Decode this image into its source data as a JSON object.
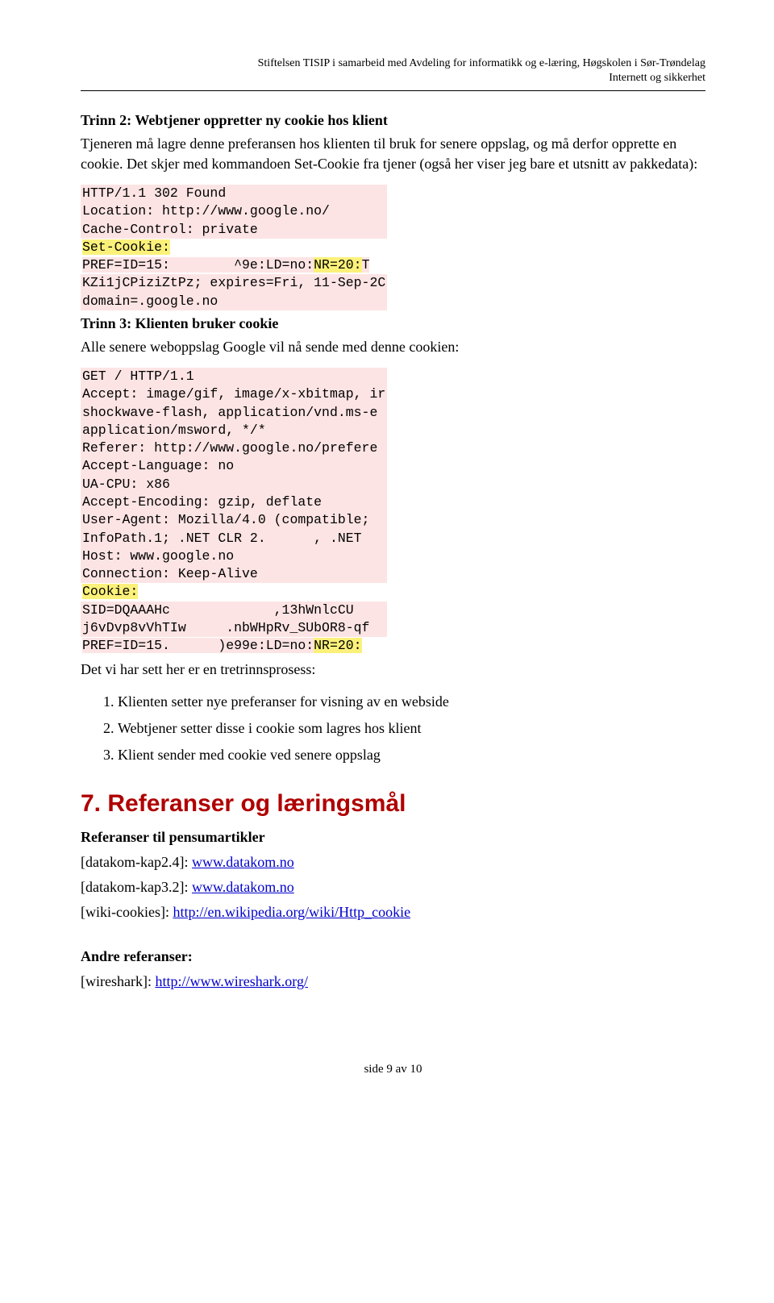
{
  "header": {
    "line1": "Stiftelsen TISIP i samarbeid med Avdeling for informatikk og e-læring, Høgskolen i Sør-Trøndelag",
    "line2": "Internett og sikkerhet"
  },
  "step2": {
    "title": "Trinn 2: Webtjener oppretter ny cookie hos klient",
    "para": "Tjeneren må lagre denne preferansen hos klienten til bruk for senere oppslag, og må derfor opprette en cookie. Det skjer med kommandoen Set-Cookie fra tjener (også her viser jeg bare et utsnitt av pakkedata):"
  },
  "step3": {
    "title": "Trinn 3: Klienten bruker cookie",
    "para": "Alle senere weboppslag Google vil nå sende med denne cookien:"
  },
  "summary": {
    "intro": "Det vi har sett her er en tretrinnsprosess:",
    "items": [
      "Klienten setter nye preferanser for visning av en webside",
      "Webtjener setter disse i cookie som lagres hos klient",
      "Klient sender med cookie ved senere oppslag"
    ]
  },
  "section7": {
    "title": "7. Referanser og læringsmål",
    "refs_heading": "Referanser til pensumartikler",
    "ref1_label": "[datakom-kap2.4]: ",
    "ref1_link": "www.datakom.no",
    "ref2_label": "[datakom-kap3.2]: ",
    "ref2_link": "www.datakom.no",
    "ref3_label": "[wiki-cookies]: ",
    "ref3_link": "http://en.wikipedia.org/wiki/Http_cookie",
    "other_heading": "Andre referanser:",
    "ref4_label": "[wireshark]: ",
    "ref4_link": "http://www.wireshark.org/"
  },
  "footer": {
    "text": "side 9 av 10"
  },
  "chart_data": [
    {
      "type": "table",
      "title": "HTTP response snippet (Set-Cookie)",
      "rows": [
        {
          "text": "HTTP/1.1 302 Found",
          "highlight": "pink"
        },
        {
          "text": "Location: http://www.google.no/",
          "highlight": "pink"
        },
        {
          "text": "Cache-Control: private",
          "highlight": "pink"
        },
        {
          "text": "Set-Cookie:",
          "highlight": "yellow"
        },
        {
          "text": "PREF=ID=15:        ^9e:LD=no:NR=20:T",
          "highlight": "pink",
          "segments": [
            {
              "t": "PREF=ID=15:        ^9e:LD=no:",
              "h": "pink"
            },
            {
              "t": "NR=20:",
              "h": "yellow"
            },
            {
              "t": "T",
              "h": "pink"
            }
          ]
        },
        {
          "text": "KZi1jCPiziZtPz; expires=Fri, 11-Sep-2C",
          "highlight": "pink"
        },
        {
          "text": "domain=.google.no",
          "highlight": "pink"
        }
      ]
    },
    {
      "type": "table",
      "title": "HTTP request snippet (Cookie)",
      "rows": [
        {
          "text": "GET / HTTP/1.1",
          "highlight": "pink"
        },
        {
          "text": "Accept: image/gif, image/x-xbitmap, ir",
          "highlight": "pink"
        },
        {
          "text": "shockwave-flash, application/vnd.ms-e",
          "highlight": "pink"
        },
        {
          "text": "application/msword, */*",
          "highlight": "pink"
        },
        {
          "text": "Referer: http://www.google.no/prefere",
          "highlight": "pink"
        },
        {
          "text": "Accept-Language: no",
          "highlight": "pink"
        },
        {
          "text": "UA-CPU: x86",
          "highlight": "pink"
        },
        {
          "text": "Accept-Encoding: gzip, deflate",
          "highlight": "pink"
        },
        {
          "text": "User-Agent: Mozilla/4.0 (compatible;",
          "highlight": "pink"
        },
        {
          "text": "InfoPath.1; .NET CLR 2.      , .NET ",
          "highlight": "pink"
        },
        {
          "text": "Host: www.google.no",
          "highlight": "pink"
        },
        {
          "text": "Connection: Keep-Alive",
          "highlight": "pink"
        },
        {
          "text": "Cookie:",
          "highlight": "yellow"
        },
        {
          "text": "SID=DQAAAHc             ,13hWnlcCU",
          "highlight": "pink"
        },
        {
          "text": "j6vDvp8vVhTIw     .nbWHpRv_SUbOR8-qf",
          "highlight": "pink"
        },
        {
          "text": "PREF=ID=15.      )e99e:LD=no:NR=20:",
          "highlight": "pink",
          "segments": [
            {
              "t": "PREF=ID=15.      )e99e:LD=no:",
              "h": "pink"
            },
            {
              "t": "NR=20:",
              "h": "yellow"
            }
          ]
        }
      ]
    }
  ]
}
